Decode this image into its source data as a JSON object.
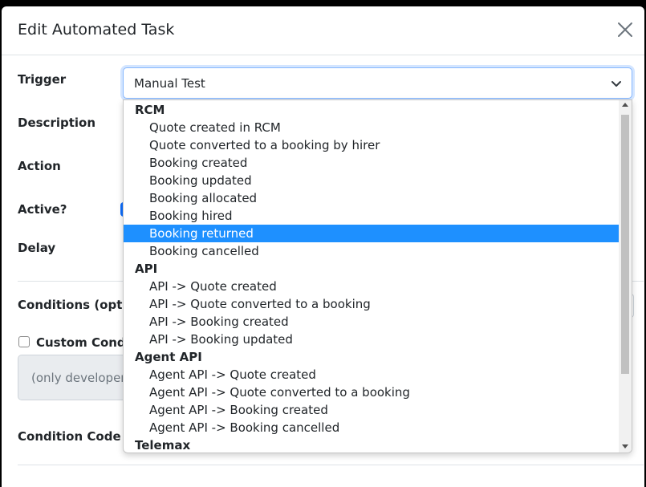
{
  "modal": {
    "title": "Edit Automated Task"
  },
  "form": {
    "trigger_label": "Trigger",
    "trigger_value": "Manual Test",
    "description_label": "Description",
    "action_label": "Action",
    "active_label": "Active?",
    "delay_label": "Delay",
    "conditions_label": "Conditions (optio",
    "custom_conditions_label": "Custom Condt",
    "custom_conditions_note": "(only developers",
    "condition_code_label": "Condition Code"
  },
  "dropdown": {
    "groups": [
      {
        "label": "RCM",
        "options": [
          "Quote created in RCM",
          "Quote converted to a booking by hirer",
          "Booking created",
          "Booking updated",
          "Booking allocated",
          "Booking hired",
          "Booking returned",
          "Booking cancelled"
        ]
      },
      {
        "label": "API",
        "options": [
          "API -> Quote created",
          "API -> Quote converted to a booking",
          "API -> Booking created",
          "API -> Booking updated"
        ]
      },
      {
        "label": "Agent API",
        "options": [
          "Agent API -> Quote created",
          "Agent API -> Quote converted to a booking",
          "Agent API -> Booking created",
          "Agent API -> Booking cancelled"
        ]
      },
      {
        "label": "Telemax",
        "options": []
      }
    ],
    "highlighted": "Booking returned"
  },
  "colors": {
    "highlight": "#1e90ff",
    "focus_border": "#86b7fe",
    "toggle_accent": "#0d6efd"
  },
  "icons": {
    "close": "close-icon",
    "chevron": "chevron-down-icon"
  }
}
